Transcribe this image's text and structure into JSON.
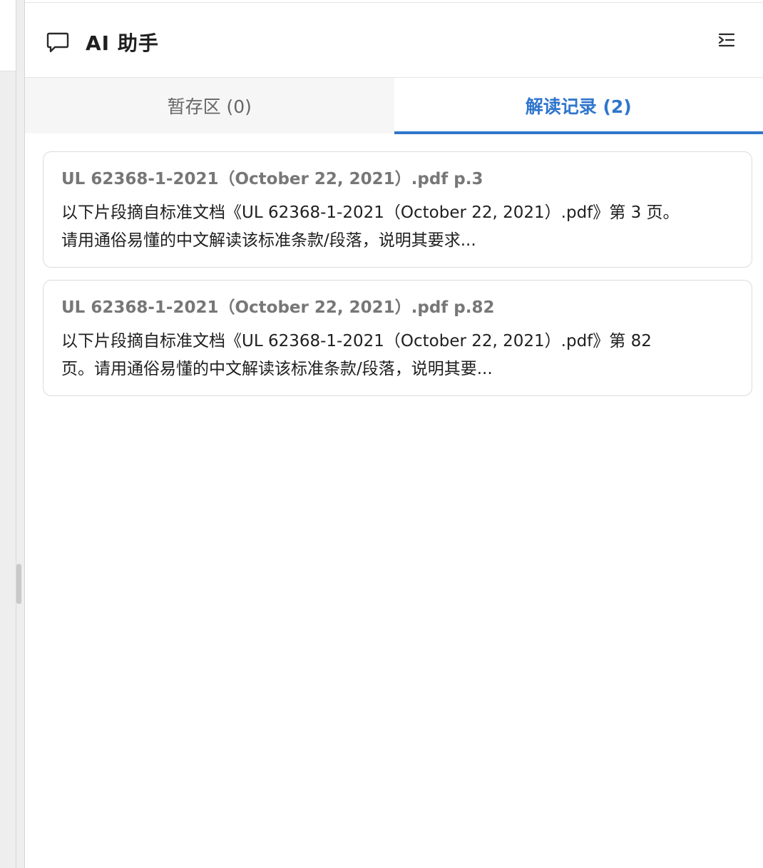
{
  "header": {
    "title": "AI 助手",
    "chat_icon": "chat-bubble-icon",
    "collapse_icon": "collapse-panel-icon"
  },
  "tabs": [
    {
      "label": "暂存区 (0)",
      "active": false
    },
    {
      "label": "解读记录 (2)",
      "active": true
    }
  ],
  "records": [
    {
      "title": "UL 62368-1-2021（October 22, 2021）.pdf p.3",
      "excerpt_line1": "以下片段摘自标准文档《UL 62368-1-2021（October 22, 2021）.pdf》第 3 页。",
      "excerpt_line2": "请用通俗易懂的中文解读该标准条款/段落，说明其要求..."
    },
    {
      "title": "UL 62368-1-2021（October 22, 2021）.pdf p.82",
      "excerpt_line1": "以下片段摘自标准文档《UL 62368-1-2021（October 22, 2021）.pdf》第 82",
      "excerpt_line2": "页。请用通俗易懂的中文解读该标准条款/段落，说明其要..."
    }
  ],
  "colors": {
    "accent": "#2f76cc",
    "inactive_tab_bg": "#f6f6f6",
    "border": "#dcdcdc"
  }
}
